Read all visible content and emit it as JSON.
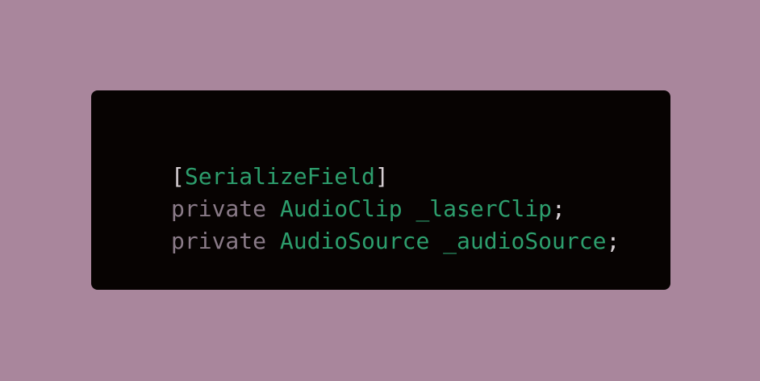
{
  "colors": {
    "background": "#a9869c",
    "card": "#070302",
    "punctuation": "#d6cfd3",
    "identifier": "#2d9e6d",
    "keyword": "#8a7b88"
  },
  "code": {
    "lines": [
      {
        "open_bracket": "[",
        "attribute": "SerializeField",
        "close_bracket": "]"
      },
      {
        "keyword": "private",
        "type": "AudioClip",
        "name": "_laserClip",
        "terminator": ";"
      },
      {
        "keyword": "private",
        "type": "AudioSource",
        "name": "_audioSource",
        "terminator": ";"
      }
    ]
  }
}
